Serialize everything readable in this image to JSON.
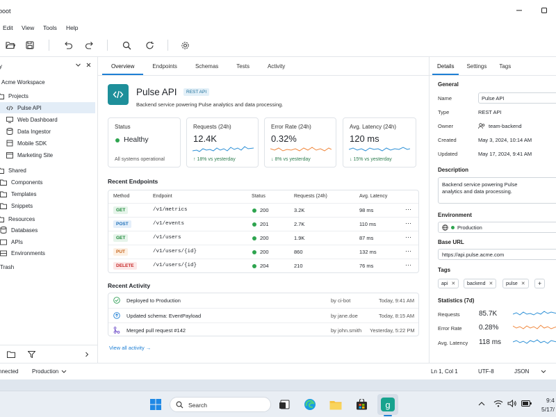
{
  "window": {
    "title": "boot",
    "minimize_icon": "minimize-icon",
    "maximize_icon": "maximize-icon"
  },
  "menu": [
    "Edit",
    "View",
    "Tools",
    "Help"
  ],
  "sidebar": {
    "header": "y",
    "workspace": "Acme Workspace",
    "groups": {
      "projects": "Projects",
      "shared": "Shared",
      "resources": "Resources",
      "trash": "Trash"
    },
    "projects": [
      "Pulse API",
      "Web Dashboard",
      "Data Ingestor",
      "Mobile SDK",
      "Marketing Site"
    ],
    "shared": [
      "Components",
      "Templates",
      "Snippets"
    ],
    "resources": [
      "Databases",
      "APIs",
      "Environments"
    ]
  },
  "tabs": [
    "Overview",
    "Endpoints",
    "Schemas",
    "Tests",
    "Activity"
  ],
  "project": {
    "name": "Pulse API",
    "badge": "REST API",
    "description": "Backend service powering Pulse analytics and data processing."
  },
  "cards": {
    "status": {
      "label": "Status",
      "value": "Healthy",
      "sub": "All systems operational"
    },
    "requests": {
      "label": "Requests (24h)",
      "value": "12.4K",
      "sub": "↑  18% vs yesterday"
    },
    "error": {
      "label": "Error Rate (24h)",
      "value": "0.32%",
      "sub": "↓  8% vs yesterday"
    },
    "latency": {
      "label": "Avg. Latency (24h)",
      "value": "120 ms",
      "sub": "↓  15% vs yesterday"
    }
  },
  "endpoints": {
    "title": "Recent Endpoints",
    "headers": [
      "Method",
      "Endpoint",
      "Status",
      "Requests (24h)",
      "Avg. Latency"
    ],
    "rows": [
      {
        "method": "GET",
        "path": "/v1/metrics",
        "status": "200",
        "requests": "3.2K",
        "latency": "98 ms"
      },
      {
        "method": "POST",
        "path": "/v1/events",
        "status": "201",
        "requests": "2.7K",
        "latency": "110 ms"
      },
      {
        "method": "GET",
        "path": "/v1/users",
        "status": "200",
        "requests": "1.9K",
        "latency": "87 ms"
      },
      {
        "method": "PUT",
        "path": "/v1/users/{id}",
        "status": "200",
        "requests": "860",
        "latency": "132 ms"
      },
      {
        "method": "DELETE",
        "path": "/v1/users/{id}",
        "status": "204",
        "requests": "210",
        "latency": "76 ms"
      }
    ]
  },
  "activity": {
    "title": "Recent Activity",
    "rows": [
      {
        "text": "Deployed to Production",
        "by": "by ci-bot",
        "time": "Today, 9:41 AM"
      },
      {
        "text": "Updated schema: EventPayload",
        "by": "by jane.doe",
        "time": "Today, 8:15 AM"
      },
      {
        "text": "Merged pull request #142",
        "by": "by john.smith",
        "time": "Yesterday, 5:22 PM"
      }
    ],
    "view_all": "View all activity  →"
  },
  "details": {
    "tabs": [
      "Details",
      "Settings",
      "Tags"
    ],
    "general": "General",
    "name_label": "Name",
    "name": "Pulse API",
    "type_label": "Type",
    "type": "REST API",
    "owner_label": "Owner",
    "owner": "team-backend",
    "created_label": "Created",
    "created": "May 3, 2024, 10:14 AM",
    "updated_label": "Updated",
    "updated": "May 17, 2024, 9:41 AM",
    "description_title": "Description",
    "description": "Backend service powering Pulse analytics and data processing.",
    "environment_title": "Environment",
    "environment": "Production",
    "base_url_title": "Base URL",
    "base_url": "https://api.pulse.acme.com",
    "tags_title": "Tags",
    "tags": [
      "api",
      "backend",
      "pulse"
    ],
    "stats_title": "Statistics (7d)",
    "stats": [
      {
        "label": "Requests",
        "value": "85.7K"
      },
      {
        "label": "Error Rate",
        "value": "0.28%"
      },
      {
        "label": "Avg. Latency",
        "value": "118 ms"
      }
    ]
  },
  "statusbar": {
    "connection": "nnected",
    "environment": "Production",
    "position": "Ln 1, Col 1",
    "encoding": "UTF-8",
    "language": "JSON"
  },
  "taskbar": {
    "search": "Search",
    "time": "9:4",
    "date": "5/17/"
  },
  "colors": {
    "accent": "#1d7fd4",
    "teal": "#1e8f9a",
    "success": "#2ea44f",
    "error_line": "#f0883e"
  }
}
